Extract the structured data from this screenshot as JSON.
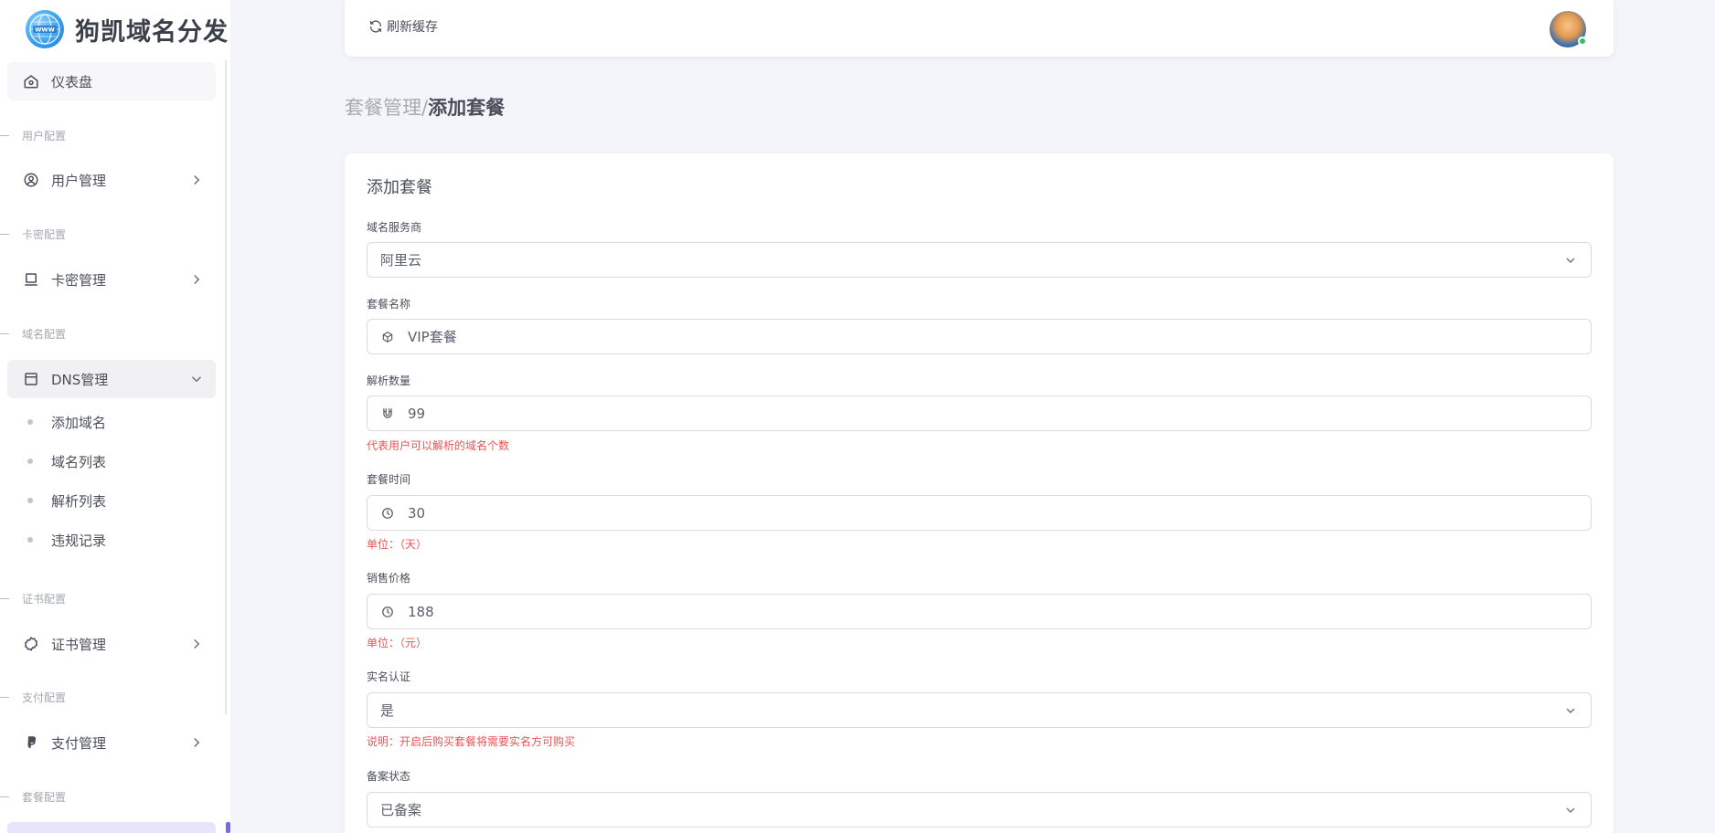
{
  "brand": {
    "title": "狗凯域名分发",
    "logo_icon": "globe-www-icon"
  },
  "topbar": {
    "refresh_label": "刷新缓存",
    "status_color": "#28c76f"
  },
  "sidebar": {
    "dashboard": "仪表盘",
    "sections": {
      "user": "用户配置",
      "card": "卡密配置",
      "domain": "域名配置",
      "cert": "证书配置",
      "payment": "支付配置",
      "package": "套餐配置"
    },
    "items": {
      "user_mgmt": "用户管理",
      "card_mgmt": "卡密管理",
      "dns_mgmt": "DNS管理",
      "cert_mgmt": "证书管理",
      "pay_mgmt": "支付管理"
    },
    "dns_sub": [
      "添加域名",
      "域名列表",
      "解析列表",
      "违规记录"
    ]
  },
  "breadcrumb": {
    "parent": "套餐管理/",
    "current": "添加套餐"
  },
  "form": {
    "title": "添加套餐",
    "provider": {
      "label": "域名服务商",
      "value": "阿里云"
    },
    "name": {
      "label": "套餐名称",
      "value": "VIP套餐"
    },
    "quota": {
      "label": "解析数量",
      "value": "99",
      "hint": "代表用户可以解析的域名个数"
    },
    "duration": {
      "label": "套餐时间",
      "value": "30",
      "hint": "单位：（天）"
    },
    "price": {
      "label": "销售价格",
      "value": "188",
      "hint": "单位：（元）"
    },
    "realname": {
      "label": "实名认证",
      "value": "是",
      "hint": "说明：开启后购买套餐将需要实名方可购买"
    },
    "icp": {
      "label": "备案状态",
      "value": "已备案"
    }
  },
  "colors": {
    "accent": "#7367f0",
    "error": "#ea5455",
    "selected_bg": "#e7e5fb"
  }
}
